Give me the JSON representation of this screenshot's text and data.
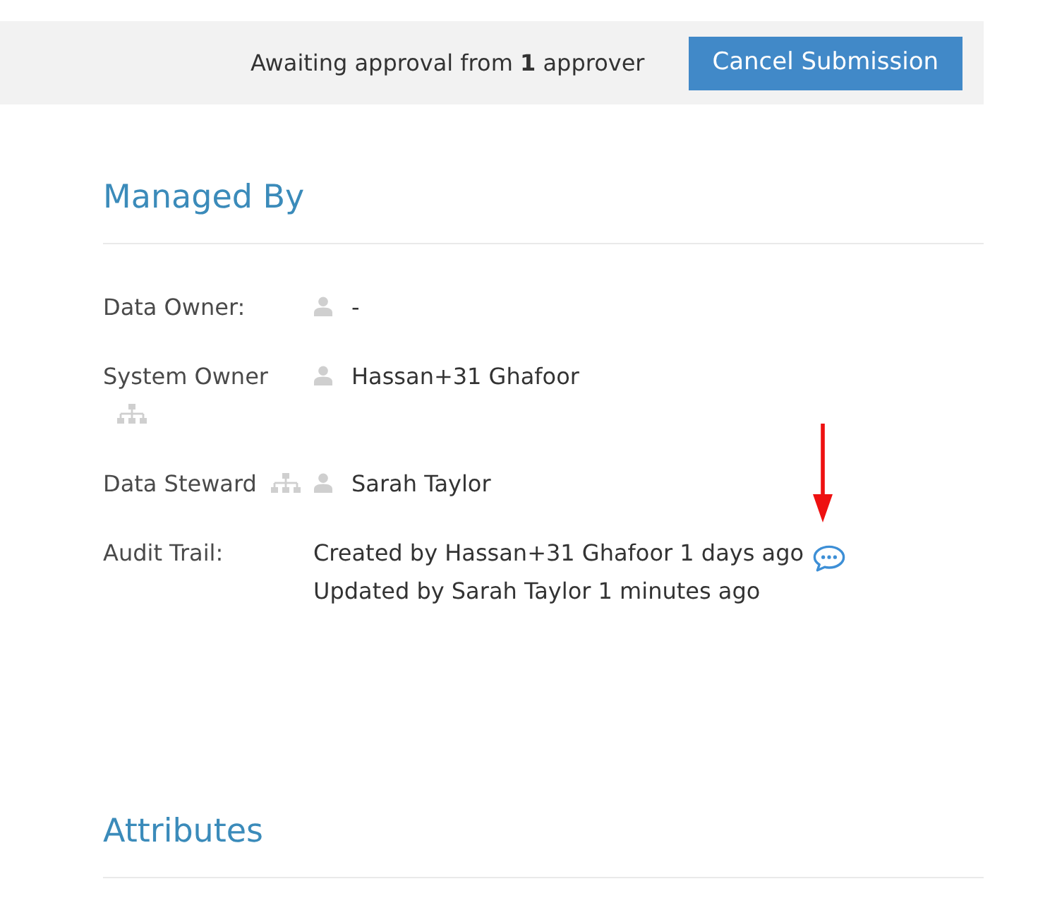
{
  "approval_bar": {
    "message": "Awaiting approval from **1** approver",
    "button": "Cancel Submission"
  },
  "sections": [
    {
      "title": "Managed By",
      "fields": [
        {
          "kind": "person",
          "label": "Data Owner:",
          "org_chart": false,
          "value": "-"
        },
        {
          "kind": "person",
          "label": "System Owner",
          "org_chart": true,
          "value": "Hassan+31 Ghafoor"
        },
        {
          "kind": "person",
          "label": "Data Steward",
          "org_chart": true,
          "value": "Sarah Taylor"
        },
        {
          "kind": "audit",
          "label": "Audit Trail:",
          "org_chart": false,
          "lines": [
            {
              "text": "Created by Hassan+31 Ghafoor 1 days ago",
              "comment": true
            },
            {
              "text": "Updated by Sarah Taylor 1 minutes ago",
              "comment": false
            }
          ]
        }
      ]
    },
    {
      "title": "Attributes"
    }
  ]
}
